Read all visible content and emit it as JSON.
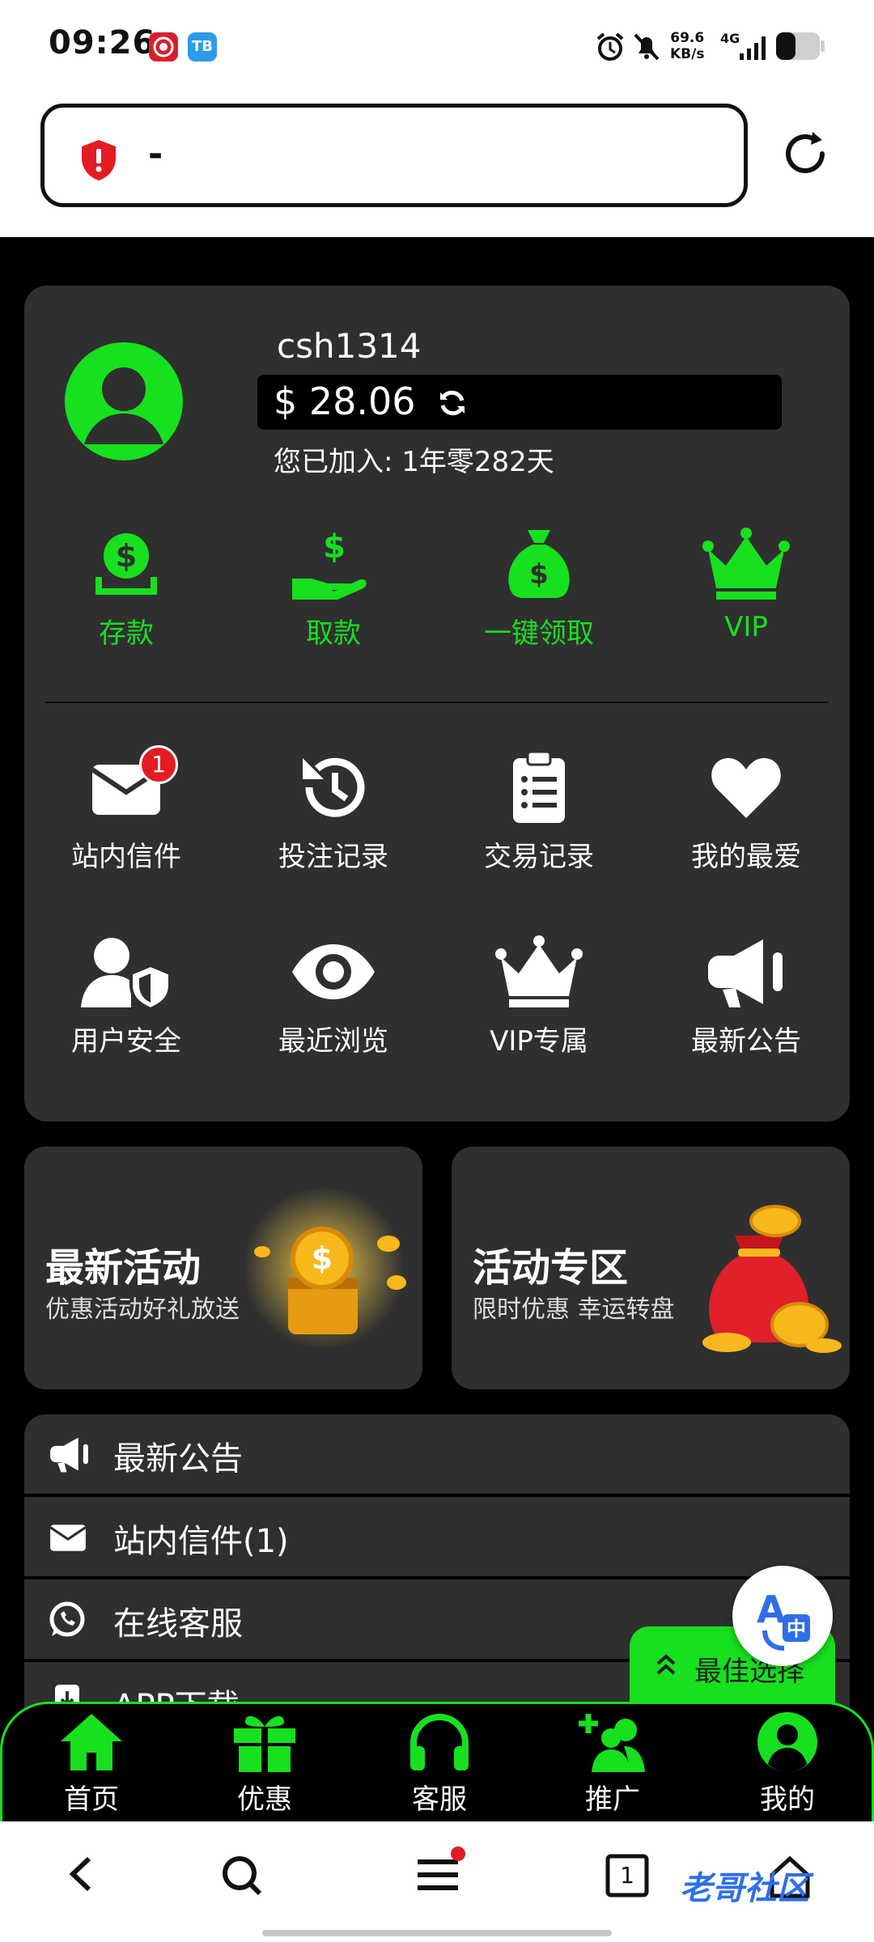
{
  "status_bar": {
    "time": "09:26",
    "app_icon_2_label": "TB",
    "net_speed_value": "69.6",
    "net_speed_unit": "KB/s",
    "network_type": "4G",
    "battery_level": 0.45
  },
  "address_bar": {
    "url_text": "-"
  },
  "profile": {
    "username": "csh1314",
    "balance": "$ 28.06",
    "joined": "您已加入: 1年零282天"
  },
  "wallet_actions": [
    {
      "label": "存款",
      "icon": "deposit-icon"
    },
    {
      "label": "取款",
      "icon": "withdraw-icon"
    },
    {
      "label": "一键领取",
      "icon": "money-bag-icon"
    },
    {
      "label": "VIP",
      "icon": "crown-icon"
    }
  ],
  "menu_grid": [
    {
      "label": "站内信件",
      "icon": "mail-icon",
      "badge": "1"
    },
    {
      "label": "投注记录",
      "icon": "history-icon"
    },
    {
      "label": "交易记录",
      "icon": "clipboard-icon"
    },
    {
      "label": "我的最爱",
      "icon": "heart-icon"
    },
    {
      "label": "用户安全",
      "icon": "user-shield-icon"
    },
    {
      "label": "最近浏览",
      "icon": "eye-icon"
    },
    {
      "label": "VIP专属",
      "icon": "crown-icon"
    },
    {
      "label": "最新公告",
      "icon": "megaphone-icon"
    }
  ],
  "promos": [
    {
      "title": "最新活动",
      "subtitle": "优惠活动好礼放送"
    },
    {
      "title": "活动专区",
      "subtitle": "限时优惠 幸运转盘"
    }
  ],
  "list": [
    {
      "label": "最新公告",
      "icon": "megaphone-icon"
    },
    {
      "label": "站内信件(1)",
      "icon": "mail-icon"
    },
    {
      "label": "在线客服",
      "icon": "whatsapp-icon"
    },
    {
      "label": "APP下载",
      "icon": "download-icon"
    }
  ],
  "best_choice_label": "最佳选择",
  "app_nav": [
    {
      "label": "首页",
      "icon": "home-icon"
    },
    {
      "label": "优惠",
      "icon": "gift-icon"
    },
    {
      "label": "客服",
      "icon": "headset-icon"
    },
    {
      "label": "推广",
      "icon": "add-user-icon"
    },
    {
      "label": "我的",
      "icon": "user-circle-icon"
    }
  ],
  "browser_bar": {
    "tab_count": "1",
    "watermark": "老哥社区"
  },
  "colors": {
    "accent_green": "#17e01f",
    "card_bg": "#2f2f2f",
    "badge_red": "#e41b23"
  }
}
